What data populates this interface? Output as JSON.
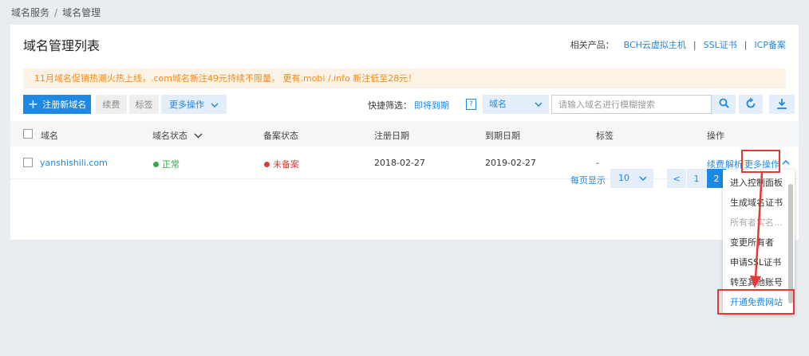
{
  "breadcrumb": {
    "item1": "域名服务",
    "sep": "/",
    "item2": "域名管理"
  },
  "page_title": "域名管理列表",
  "related": {
    "label": "相关产品：",
    "links": [
      "BCH云虚拟主机",
      "SSL证书",
      "ICP备案"
    ],
    "divider": "|"
  },
  "promo": "11月域名促销热潮火热上线，.com域名新注49元持续不限量， 更有.mobi /.info 新注低至28元！",
  "toolbar": {
    "register": "注册新域名",
    "renew": "续费",
    "tag": "标签",
    "more": "更多操作",
    "quick_filter_label": "快捷筛选：",
    "quick_filter_link": "即将到期",
    "help": "?",
    "search_type": "域名",
    "search_placeholder": "请输入域名进行模糊搜索"
  },
  "icons": {
    "search": "search-icon",
    "refresh": "refresh-icon",
    "download": "download-icon",
    "chevron": "chevron-down-icon"
  },
  "table": {
    "headers": [
      "域名",
      "域名状态",
      "备案状态",
      "注册日期",
      "到期日期",
      "标签",
      "操作"
    ],
    "rows": [
      {
        "domain": "yanshishili.com",
        "status": "正常",
        "beian": "未备案",
        "reg_date": "2018-02-27",
        "exp_date": "2019-02-27",
        "tag": "-",
        "actions": [
          "续费",
          "解析",
          "更多操作"
        ]
      }
    ]
  },
  "pagination": {
    "label": "每页显示",
    "per_page": "10",
    "prev": "<",
    "pages": [
      "1",
      "2"
    ]
  },
  "dropdown": {
    "items": [
      "进入控制面板",
      "生成域名证书",
      "所有者实名...",
      "变更所有者",
      "申请SSL证书",
      "转至其他账号",
      "开通免费网站"
    ]
  },
  "colors": {
    "accent": "#1e88e5",
    "success": "#2eaa4a",
    "danger": "#e53935",
    "promo_text": "#f0891c",
    "promo_bg": "#fdf3e4"
  }
}
